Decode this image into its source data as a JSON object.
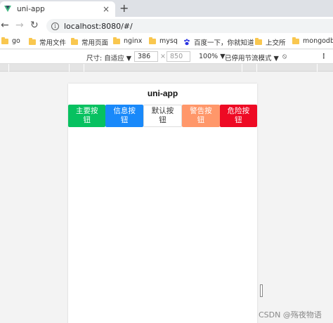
{
  "browser": {
    "tab_title": "uni-app",
    "tab_close": "×",
    "new_tab": "+",
    "url": "localhost:8080/#/"
  },
  "bookmarks": [
    {
      "label": "go"
    },
    {
      "label": "常用文件"
    },
    {
      "label": "常用页面"
    },
    {
      "label": "nginx"
    },
    {
      "label": "mysq"
    },
    {
      "label": "百度一下，你就知道"
    },
    {
      "label": "上交所"
    },
    {
      "label": "mongodb"
    }
  ],
  "device_toolbar": {
    "size_label": "尺寸: 自适应",
    "width": "386",
    "times": "×",
    "height": "850",
    "zoom": "100%",
    "throttle": "已停用节流模式",
    "more": "⋮"
  },
  "app": {
    "nav_title": "uni-app",
    "buttons": {
      "primary": "主要按钮",
      "info": "信息按钮",
      "default": "默认按钮",
      "warning": "警告按钮",
      "danger": "危险按钮"
    }
  },
  "watermark": "CSDN @殇夜物语",
  "colors": {
    "primary": "#07c160",
    "info": "#1989fa",
    "warning": "#ff976a",
    "danger": "#ee0a24"
  },
  "icons": [
    "vue-logo-icon",
    "close-icon",
    "plus-icon",
    "back-arrow-icon",
    "forward-arrow-icon",
    "reload-icon",
    "info-icon",
    "folder-icon",
    "baidu-paw-icon",
    "chevron-down-icon",
    "no-sign-icon",
    "more-vert-icon"
  ]
}
